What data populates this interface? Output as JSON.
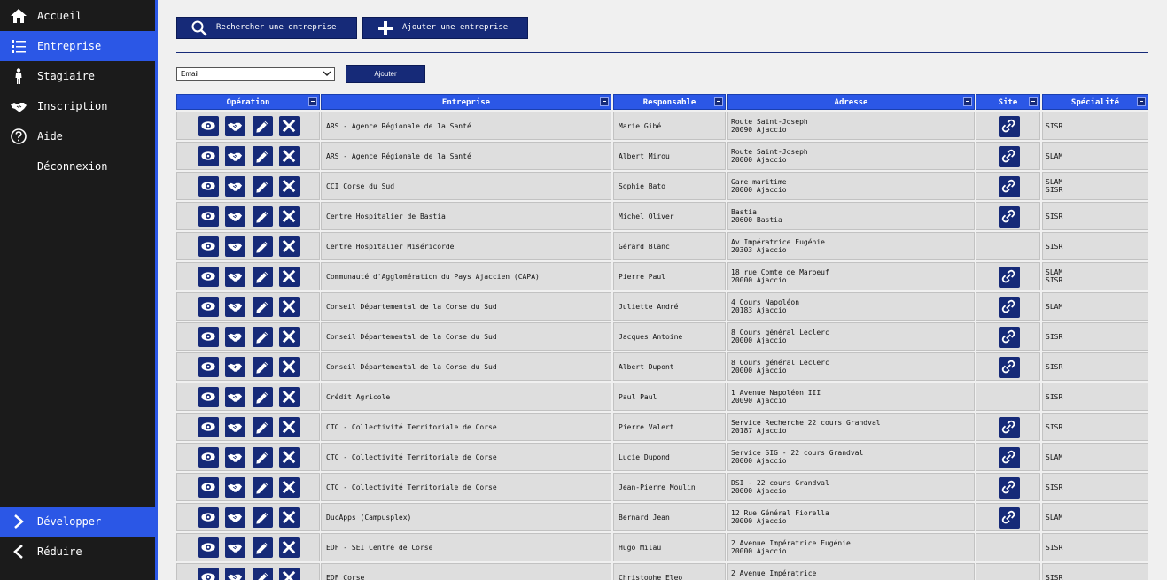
{
  "sidebar": {
    "items": [
      {
        "label": "Accueil",
        "icon": "home-icon",
        "active": false
      },
      {
        "label": "Entreprise",
        "icon": "list-icon",
        "active": true
      },
      {
        "label": "Stagiaire",
        "icon": "person-icon",
        "active": false
      },
      {
        "label": "Inscription",
        "icon": "handshake-icon",
        "active": false
      },
      {
        "label": "Aide",
        "icon": "help-icon",
        "active": false
      },
      {
        "label": "Déconnexion",
        "icon": "",
        "active": false
      }
    ],
    "bottom": [
      {
        "label": "Développer",
        "icon": "chevron-right-icon",
        "active": true
      },
      {
        "label": "Réduire",
        "icon": "chevron-left-icon",
        "active": false
      }
    ]
  },
  "toolbar": {
    "search_label": "Rechercher une entreprise",
    "add_label": "Ajouter une entreprise"
  },
  "filter": {
    "selected": "Email",
    "add_label": "Ajouter"
  },
  "table": {
    "columns": [
      "Opération",
      "Entreprise",
      "Responsable",
      "Adresse",
      "Site",
      "Spécialité"
    ],
    "rows": [
      {
        "entreprise": "ARS - Agence Régionale de la Santé",
        "responsable": "Marie Gibé",
        "adresse1": "Route Saint-Joseph",
        "adresse2": "20090 Ajaccio",
        "site": true,
        "specialite1": "SISR",
        "specialite2": ""
      },
      {
        "entreprise": "ARS - Agence Régionale de la Santé",
        "responsable": "Albert Mirou",
        "adresse1": "Route Saint-Joseph",
        "adresse2": "20000 Ajaccio",
        "site": true,
        "specialite1": "SLAM",
        "specialite2": ""
      },
      {
        "entreprise": "CCI Corse du Sud",
        "responsable": "Sophie Bato",
        "adresse1": "Gare maritime",
        "adresse2": "20000 Ajaccio",
        "site": true,
        "specialite1": "SLAM",
        "specialite2": "SISR"
      },
      {
        "entreprise": "Centre Hospitalier de Bastia",
        "responsable": "Michel Oliver",
        "adresse1": "Bastia",
        "adresse2": "20600 Bastia",
        "site": true,
        "specialite1": "SISR",
        "specialite2": ""
      },
      {
        "entreprise": "Centre Hospitalier Miséricorde",
        "responsable": "Gérard Blanc",
        "adresse1": "Av Impératrice Eugénie",
        "adresse2": "20303 Ajaccio",
        "site": false,
        "specialite1": "SISR",
        "specialite2": ""
      },
      {
        "entreprise": "Communauté d'Agglomération du Pays Ajaccien (CAPA)",
        "responsable": "Pierre Paul",
        "adresse1": "18 rue Comte de Marbeuf",
        "adresse2": "20000 Ajaccio",
        "site": true,
        "specialite1": "SLAM",
        "specialite2": "SISR"
      },
      {
        "entreprise": "Conseil Départemental de la Corse du Sud",
        "responsable": "Juliette André",
        "adresse1": "4 Cours Napoléon",
        "adresse2": "20183 Ajaccio",
        "site": true,
        "specialite1": "SLAM",
        "specialite2": ""
      },
      {
        "entreprise": "Conseil Départemental de la Corse du Sud",
        "responsable": "Jacques Antoine",
        "adresse1": "8 Cours général Leclerc",
        "adresse2": "20000 Ajaccio",
        "site": true,
        "specialite1": "SISR",
        "specialite2": ""
      },
      {
        "entreprise": "Conseil Départemental de la Corse du Sud",
        "responsable": "Albert Dupont",
        "adresse1": "8 Cours général Leclerc",
        "adresse2": "20000 Ajaccio",
        "site": true,
        "specialite1": "SISR",
        "specialite2": ""
      },
      {
        "entreprise": "Crédit Agricole",
        "responsable": "Paul Paul",
        "adresse1": "1 Avenue Napoléon III",
        "adresse2": "20090 Ajaccio",
        "site": false,
        "specialite1": "SISR",
        "specialite2": ""
      },
      {
        "entreprise": "CTC - Collectivité Territoriale de Corse",
        "responsable": "Pierre Valert",
        "adresse1": "Service Recherche 22 cours Grandval",
        "adresse2": "20187 Ajaccio",
        "site": true,
        "specialite1": "SISR",
        "specialite2": ""
      },
      {
        "entreprise": "CTC - Collectivité Territoriale de Corse",
        "responsable": "Lucie Dupond",
        "adresse1": "Service SIG - 22 cours Grandval",
        "adresse2": "20000 Ajaccio",
        "site": true,
        "specialite1": "SLAM",
        "specialite2": ""
      },
      {
        "entreprise": "CTC - Collectivité Territoriale de Corse",
        "responsable": "Jean-Pierre Moulin",
        "adresse1": "DSI - 22 cours Grandval",
        "adresse2": "20000 Ajaccio",
        "site": true,
        "specialite1": "SISR",
        "specialite2": ""
      },
      {
        "entreprise": "DucApps (Campusplex)",
        "responsable": "Bernard Jean",
        "adresse1": "12 Rue Général Fiorella",
        "adresse2": "20000 Ajaccio",
        "site": true,
        "specialite1": "SLAM",
        "specialite2": ""
      },
      {
        "entreprise": "EDF - SEI Centre de Corse",
        "responsable": "Hugo Milau",
        "adresse1": "2 Avenue Impératrice Eugénie",
        "adresse2": "20000 Ajaccio",
        "site": false,
        "specialite1": "SISR",
        "specialite2": ""
      },
      {
        "entreprise": "EDF Corse",
        "responsable": "Christophe Eleo",
        "adresse1": "2 Avenue Impératrice",
        "adresse2": "",
        "site": false,
        "specialite1": "SISR",
        "specialite2": ""
      }
    ]
  },
  "colors": {
    "accent": "#2b57e6",
    "dark_blue": "#162a78",
    "sidebar_bg": "#1b1b1b",
    "cell_bg": "#dedede"
  }
}
